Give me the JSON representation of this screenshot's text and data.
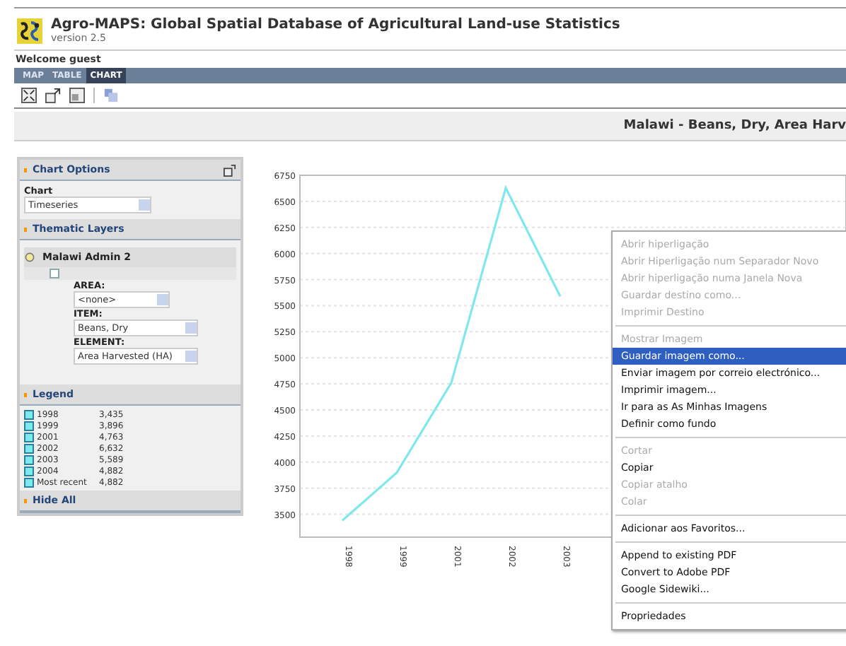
{
  "header": {
    "title": "Agro-MAPS: Global Spatial Database of Agricultural Land-use Statistics",
    "version": "version 2.5"
  },
  "welcome": "Welcome  guest",
  "tabs": [
    {
      "label": "MAP",
      "selected": false
    },
    {
      "label": "TABLE",
      "selected": false
    },
    {
      "label": "CHART",
      "selected": true
    }
  ],
  "page_title": "Malawi - Beans, Dry, Area Harv",
  "panel": {
    "chart_options": {
      "title": "Chart Options",
      "label": "Chart",
      "value": "Timeseries"
    },
    "thematic_layers": {
      "title": "Thematic Layers",
      "layer": "Malawi Admin 2",
      "fields": [
        {
          "label": "AREA:",
          "value": "<none>"
        },
        {
          "label": "ITEM:",
          "value": "Beans, Dry"
        },
        {
          "label": "ELEMENT:",
          "value": "Area Harvested (HA)"
        }
      ]
    },
    "legend": {
      "title": "Legend",
      "rows": [
        {
          "year": "1998",
          "value": "3,435"
        },
        {
          "year": "1999",
          "value": "3,896"
        },
        {
          "year": "2001",
          "value": "4,763"
        },
        {
          "year": "2002",
          "value": "6,632"
        },
        {
          "year": "2003",
          "value": "5,589"
        },
        {
          "year": "2004",
          "value": "4,882"
        },
        {
          "year": "Most recent",
          "value": "4,882"
        }
      ]
    },
    "hide_all": "Hide All"
  },
  "chart": {
    "chart_data": {
      "type": "line",
      "categories": [
        "1998",
        "1999",
        "2001",
        "2002",
        "2003"
      ],
      "grid": true,
      "series": [
        {
          "color": "#7fe8ec",
          "values": [
            3440,
            3900,
            4760,
            6630,
            5590
          ]
        }
      ],
      "ylim": [
        3280,
        6750
      ],
      "yticks": [
        3500,
        3750,
        4000,
        4250,
        4500,
        4750,
        5000,
        5250,
        5500,
        5750,
        6000,
        6250,
        6500,
        6750
      ]
    }
  },
  "context_menu": {
    "groups": [
      [
        {
          "label": "Abrir hiperligação",
          "disabled": true,
          "selected": false
        },
        {
          "label": "Abrir Hiperligação num Separador Novo",
          "disabled": true,
          "selected": false
        },
        {
          "label": "Abrir hiperligação numa Janela Nova",
          "disabled": true,
          "selected": false
        },
        {
          "label": "Guardar destino como...",
          "disabled": true,
          "selected": false
        },
        {
          "label": "Imprimir Destino",
          "disabled": true,
          "selected": false
        }
      ],
      [
        {
          "label": "Mostrar Imagem",
          "disabled": true,
          "selected": false
        },
        {
          "label": "Guardar imagem como...",
          "disabled": false,
          "selected": true
        },
        {
          "label": "Enviar imagem por correio electrónico...",
          "disabled": false,
          "selected": false
        },
        {
          "label": "Imprimir imagem...",
          "disabled": false,
          "selected": false
        },
        {
          "label": "Ir para as As Minhas Imagens",
          "disabled": false,
          "selected": false
        },
        {
          "label": "Definir como fundo",
          "disabled": false,
          "selected": false
        }
      ],
      [
        {
          "label": "Cortar",
          "disabled": true,
          "selected": false
        },
        {
          "label": "Copiar",
          "disabled": false,
          "selected": false
        },
        {
          "label": "Copiar atalho",
          "disabled": true,
          "selected": false
        },
        {
          "label": "Colar",
          "disabled": true,
          "selected": false
        }
      ],
      [
        {
          "label": "Adicionar aos Favoritos...",
          "disabled": false,
          "selected": false
        }
      ],
      [
        {
          "label": "Append to existing PDF",
          "disabled": false,
          "selected": false
        },
        {
          "label": "Convert to Adobe PDF",
          "disabled": false,
          "selected": false
        },
        {
          "label": "Google Sidewiki...",
          "disabled": false,
          "selected": false
        }
      ],
      [
        {
          "label": "Propriedades",
          "disabled": false,
          "selected": false
        }
      ]
    ]
  }
}
